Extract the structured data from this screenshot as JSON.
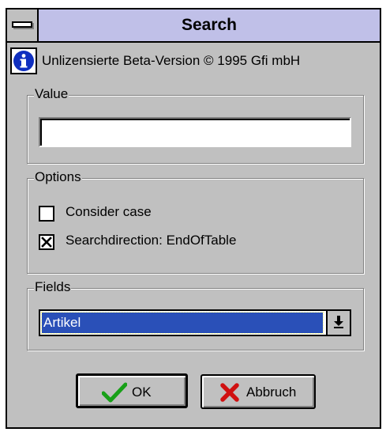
{
  "window": {
    "title": "Search",
    "info_text": "Unlizensierte Beta-Version © 1995 Gfi mbH"
  },
  "value_group": {
    "label": "Value",
    "input_value": ""
  },
  "options_group": {
    "label": "Options",
    "consider_case": {
      "label": "Consider case",
      "checked": false
    },
    "search_direction": {
      "label": "Searchdirection: EndOfTable",
      "checked": true
    }
  },
  "fields_group": {
    "label": "Fields",
    "selected": "Artikel"
  },
  "buttons": {
    "ok_label": "OK",
    "cancel_label": "Abbruch"
  },
  "colors": {
    "titlebar": "#c0c0e8",
    "dialog_bg": "#c0c0c0",
    "selection": "#2a50b8",
    "ok_check": "#18a018",
    "cancel_x": "#d01010",
    "info_icon": "#1030c0"
  },
  "icons": {
    "system_menu": "system-menu-icon",
    "info": "info-icon",
    "checkmark": "check-icon",
    "cross": "x-icon",
    "dropdown": "dropdown-arrow-icon"
  }
}
